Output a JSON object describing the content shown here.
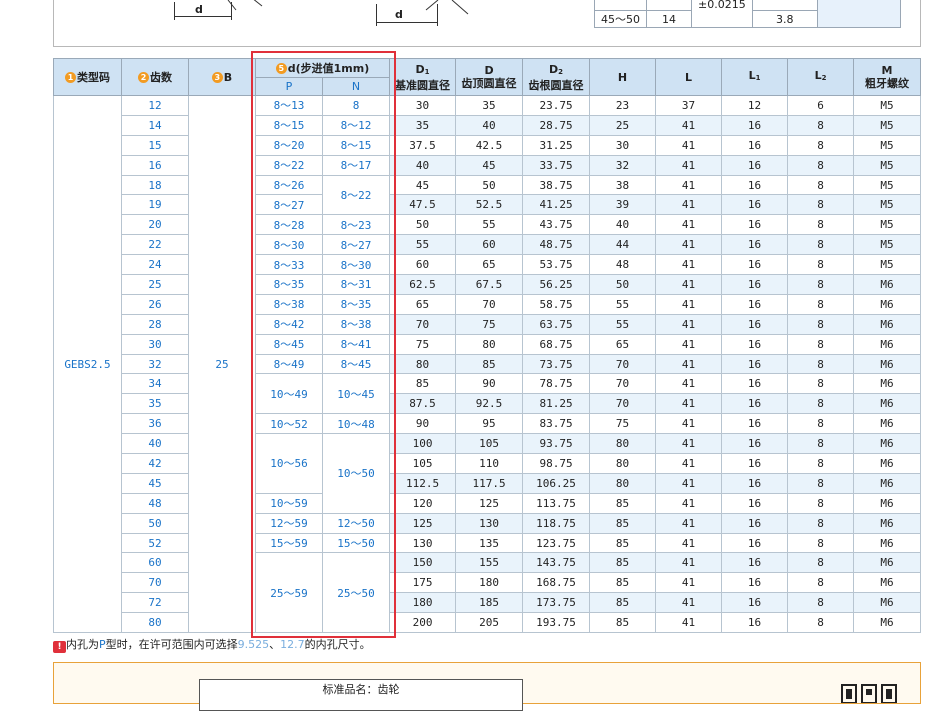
{
  "top_panel": {
    "dim_label_1": "d",
    "dim_label_2": "d",
    "mini_table": {
      "range": "45～50",
      "teeth": "14",
      "tolerance": "±0.0215",
      "value": "3.8"
    }
  },
  "headers": {
    "type_code": "类型码",
    "teeth": "齿数",
    "b": "B",
    "d_step": "d(步进值1mm)",
    "p": "P",
    "n": "N",
    "d1_sym": "D",
    "d1_sub": "1",
    "d1_name": "基准圆直径",
    "d_sym": "D",
    "d_name": "齿顶圆直径",
    "d2_sym": "D",
    "d2_sub": "2",
    "d2_name": "齿根圆直径",
    "h": "H",
    "l": "L",
    "l1_sym": "L",
    "l1_sub": "1",
    "l2_sym": "L",
    "l2_sub": "2",
    "m_sym": "M",
    "m_name": "粗牙螺纹",
    "num1": "1",
    "num2": "2",
    "num3": "3",
    "num5": "5"
  },
  "type_code": "GEBS2.5",
  "b_value": "25",
  "rows": [
    {
      "z": "12",
      "p": "8～13",
      "n": "8",
      "d1": "30",
      "d": "35",
      "d2": "23.75",
      "h": "23",
      "l": "37",
      "l1": "12",
      "l2": "6",
      "m": "M5"
    },
    {
      "z": "14",
      "p": "8～15",
      "n": "8～12",
      "d1": "35",
      "d": "40",
      "d2": "28.75",
      "h": "25",
      "l": "41",
      "l1": "16",
      "l2": "8",
      "m": "M5"
    },
    {
      "z": "15",
      "p": "8～20",
      "n": "8～15",
      "d1": "37.5",
      "d": "42.5",
      "d2": "31.25",
      "h": "30",
      "l": "41",
      "l1": "16",
      "l2": "8",
      "m": "M5"
    },
    {
      "z": "16",
      "p": "8～22",
      "n": "8～17",
      "d1": "40",
      "d": "45",
      "d2": "33.75",
      "h": "32",
      "l": "41",
      "l1": "16",
      "l2": "8",
      "m": "M5"
    },
    {
      "z": "18",
      "p": "8～26",
      "n": "8～22",
      "d1": "45",
      "d": "50",
      "d2": "38.75",
      "h": "38",
      "l": "41",
      "l1": "16",
      "l2": "8",
      "m": "M5"
    },
    {
      "z": "19",
      "p": "8～27",
      "n": "",
      "d1": "47.5",
      "d": "52.5",
      "d2": "41.25",
      "h": "39",
      "l": "41",
      "l1": "16",
      "l2": "8",
      "m": "M5"
    },
    {
      "z": "20",
      "p": "8～28",
      "n": "8～23",
      "d1": "50",
      "d": "55",
      "d2": "43.75",
      "h": "40",
      "l": "41",
      "l1": "16",
      "l2": "8",
      "m": "M5"
    },
    {
      "z": "22",
      "p": "8～30",
      "n": "8～27",
      "d1": "55",
      "d": "60",
      "d2": "48.75",
      "h": "44",
      "l": "41",
      "l1": "16",
      "l2": "8",
      "m": "M5"
    },
    {
      "z": "24",
      "p": "8～33",
      "n": "8～30",
      "d1": "60",
      "d": "65",
      "d2": "53.75",
      "h": "48",
      "l": "41",
      "l1": "16",
      "l2": "8",
      "m": "M5"
    },
    {
      "z": "25",
      "p": "8～35",
      "n": "8～31",
      "d1": "62.5",
      "d": "67.5",
      "d2": "56.25",
      "h": "50",
      "l": "41",
      "l1": "16",
      "l2": "8",
      "m": "M6"
    },
    {
      "z": "26",
      "p": "8～38",
      "n": "8～35",
      "d1": "65",
      "d": "70",
      "d2": "58.75",
      "h": "55",
      "l": "41",
      "l1": "16",
      "l2": "8",
      "m": "M6"
    },
    {
      "z": "28",
      "p": "8～42",
      "n": "8～38",
      "d1": "70",
      "d": "75",
      "d2": "63.75",
      "h": "55",
      "l": "41",
      "l1": "16",
      "l2": "8",
      "m": "M6"
    },
    {
      "z": "30",
      "p": "8～45",
      "n": "8～41",
      "d1": "75",
      "d": "80",
      "d2": "68.75",
      "h": "65",
      "l": "41",
      "l1": "16",
      "l2": "8",
      "m": "M6"
    },
    {
      "z": "32",
      "p": "8～49",
      "n": "8～45",
      "d1": "80",
      "d": "85",
      "d2": "73.75",
      "h": "70",
      "l": "41",
      "l1": "16",
      "l2": "8",
      "m": "M6"
    },
    {
      "z": "34",
      "p": "10～49",
      "n": "10～45",
      "d1": "85",
      "d": "90",
      "d2": "78.75",
      "h": "70",
      "l": "41",
      "l1": "16",
      "l2": "8",
      "m": "M6"
    },
    {
      "z": "35",
      "p": "",
      "n": "",
      "d1": "87.5",
      "d": "92.5",
      "d2": "81.25",
      "h": "70",
      "l": "41",
      "l1": "16",
      "l2": "8",
      "m": "M6"
    },
    {
      "z": "36",
      "p": "10～52",
      "n": "10～48",
      "d1": "90",
      "d": "95",
      "d2": "83.75",
      "h": "75",
      "l": "41",
      "l1": "16",
      "l2": "8",
      "m": "M6"
    },
    {
      "z": "40",
      "p": "10～56",
      "n": "10～50",
      "d1": "100",
      "d": "105",
      "d2": "93.75",
      "h": "80",
      "l": "41",
      "l1": "16",
      "l2": "8",
      "m": "M6"
    },
    {
      "z": "42",
      "p": "",
      "n": "",
      "d1": "105",
      "d": "110",
      "d2": "98.75",
      "h": "80",
      "l": "41",
      "l1": "16",
      "l2": "8",
      "m": "M6"
    },
    {
      "z": "45",
      "p": "",
      "n": "",
      "d1": "112.5",
      "d": "117.5",
      "d2": "106.25",
      "h": "80",
      "l": "41",
      "l1": "16",
      "l2": "8",
      "m": "M6"
    },
    {
      "z": "48",
      "p": "10～59",
      "n": "",
      "d1": "120",
      "d": "125",
      "d2": "113.75",
      "h": "85",
      "l": "41",
      "l1": "16",
      "l2": "8",
      "m": "M6"
    },
    {
      "z": "50",
      "p": "12～59",
      "n": "12～50",
      "d1": "125",
      "d": "130",
      "d2": "118.75",
      "h": "85",
      "l": "41",
      "l1": "16",
      "l2": "8",
      "m": "M6"
    },
    {
      "z": "52",
      "p": "15～59",
      "n": "15～50",
      "d1": "130",
      "d": "135",
      "d2": "123.75",
      "h": "85",
      "l": "41",
      "l1": "16",
      "l2": "8",
      "m": "M6"
    },
    {
      "z": "60",
      "p": "25～59",
      "n": "25～50",
      "d1": "150",
      "d": "155",
      "d2": "143.75",
      "h": "85",
      "l": "41",
      "l1": "16",
      "l2": "8",
      "m": "M6"
    },
    {
      "z": "70",
      "p": "",
      "n": "",
      "d1": "175",
      "d": "180",
      "d2": "168.75",
      "h": "85",
      "l": "41",
      "l1": "16",
      "l2": "8",
      "m": "M6"
    },
    {
      "z": "72",
      "p": "",
      "n": "",
      "d1": "180",
      "d": "185",
      "d2": "173.75",
      "h": "85",
      "l": "41",
      "l1": "16",
      "l2": "8",
      "m": "M6"
    },
    {
      "z": "80",
      "p": "",
      "n": "",
      "d1": "200",
      "d": "205",
      "d2": "193.75",
      "h": "85",
      "l": "41",
      "l1": "16",
      "l2": "8",
      "m": "M6"
    }
  ],
  "spans": {
    "p": [
      [
        0,
        1
      ],
      [
        1,
        1
      ],
      [
        2,
        1
      ],
      [
        3,
        1
      ],
      [
        4,
        1
      ],
      [
        5,
        1
      ],
      [
        6,
        1
      ],
      [
        7,
        1
      ],
      [
        8,
        1
      ],
      [
        9,
        1
      ],
      [
        10,
        1
      ],
      [
        11,
        1
      ],
      [
        12,
        1
      ],
      [
        13,
        1
      ],
      [
        14,
        2
      ],
      [
        16,
        1
      ],
      [
        17,
        3
      ],
      [
        20,
        1
      ],
      [
        21,
        1
      ],
      [
        22,
        1
      ],
      [
        23,
        4
      ]
    ],
    "n": [
      [
        0,
        1
      ],
      [
        1,
        1
      ],
      [
        2,
        1
      ],
      [
        3,
        1
      ],
      [
        4,
        2
      ],
      [
        6,
        1
      ],
      [
        7,
        1
      ],
      [
        8,
        1
      ],
      [
        9,
        1
      ],
      [
        10,
        1
      ],
      [
        11,
        1
      ],
      [
        12,
        1
      ],
      [
        13,
        1
      ],
      [
        14,
        2
      ],
      [
        16,
        1
      ],
      [
        17,
        4
      ],
      [
        21,
        1
      ],
      [
        22,
        1
      ],
      [
        23,
        4
      ]
    ]
  },
  "note": {
    "icon": "!",
    "part1": "内孔为",
    "p_letter": "P",
    "part2": "型时，在许可范围内可选择",
    "size1": "9.525",
    "sep": "、",
    "size2": "12.7",
    "part3": "的内孔尺寸。"
  },
  "bottom_panel": {
    "label": "标准品名：齿轮",
    "qr": "qr-icon"
  },
  "colors": {
    "header_bg": "#cfe2f3",
    "alt_row_bg": "#e9f3fb",
    "accent_blue": "#1a73c8",
    "badge_orange": "#f29b22",
    "frame_red": "#e0303a"
  }
}
